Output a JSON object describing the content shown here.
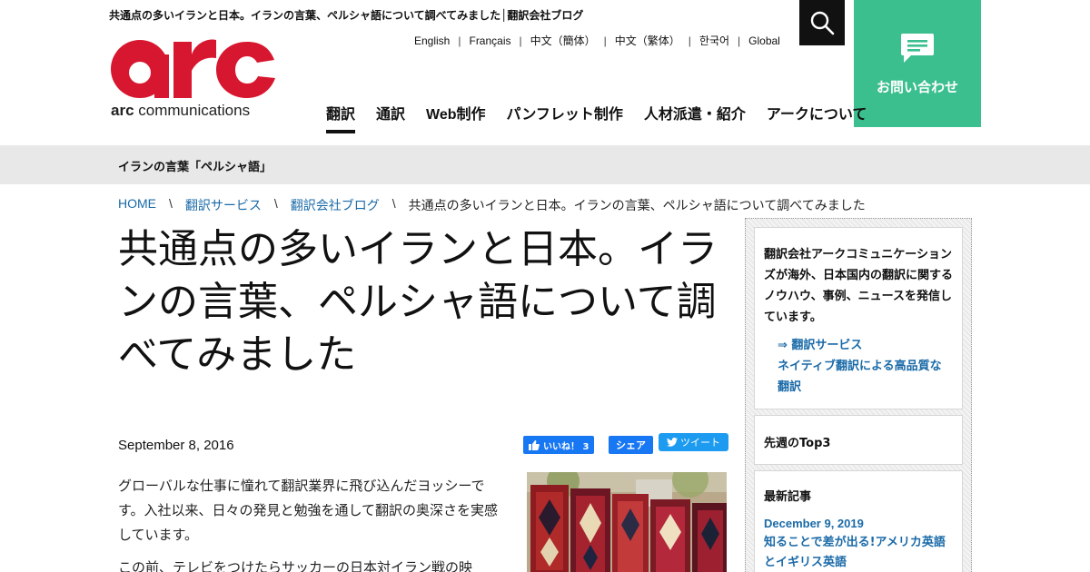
{
  "header": {
    "tagline": "共通点の多いイランと日本。イランの言葉、ペルシャ語について調べてみました│翻訳会社ブログ",
    "logo_text_bold": "arc",
    "logo_text_rest": " communications",
    "logo_color": "#d7172f",
    "languages": [
      "English",
      "Français",
      "中文（簡体）",
      "中文（繁体）",
      "한국어",
      "Global"
    ],
    "search_icon": "search-icon",
    "contact_label": "お問い合わせ",
    "contact_icon": "chat-bubble-icon",
    "contact_color": "#3bbf8f"
  },
  "nav": {
    "items": [
      "翻訳",
      "通訳",
      "Web制作",
      "パンフレット制作",
      "人材派遣・紹介",
      "アークについて"
    ],
    "active": "翻訳"
  },
  "category": {
    "title": "イランの言葉「ペルシャ語」"
  },
  "breadcrumb": {
    "items": [
      "HOME",
      "翻訳サービス",
      "翻訳会社ブログ"
    ],
    "current": "共通点の多いイランと日本。イランの言葉、ペルシャ語について調べてみました"
  },
  "article": {
    "title": "共通点の多いイランと日本。イランの言葉、ペルシャ語について調べてみました",
    "date": "September 8, 2016",
    "paragraph1": "グローバルな仕事に憧れて翻訳業界に飛び込んだヨッシーです。入社以来、日々の発見と勉強を通して翻訳の奥深さを実感しています。",
    "paragraph2": "この前、テレビをつけたらサッカーの日本対イラン戦の映",
    "image_alt": "Persian carpets photo"
  },
  "social": {
    "like_label": "いいね！ 3",
    "share_label": "シェア",
    "tweet_label": "ツイート"
  },
  "sidebar": {
    "intro": "翻訳会社アークコミュニケーションズが海外、日本国内の翻訳に関するノウハウ、事例、ニュースを発信しています。",
    "link1": "⇒ 翻訳サービス",
    "link2": "ネイティブ翻訳による高品質な翻訳",
    "top3_heading": "先週のTop3",
    "recent_heading": "最新記事",
    "recent_date": "December 9, 2019",
    "recent_post": "知ることで差が出る!アメリカ英語とイギリス英語"
  }
}
